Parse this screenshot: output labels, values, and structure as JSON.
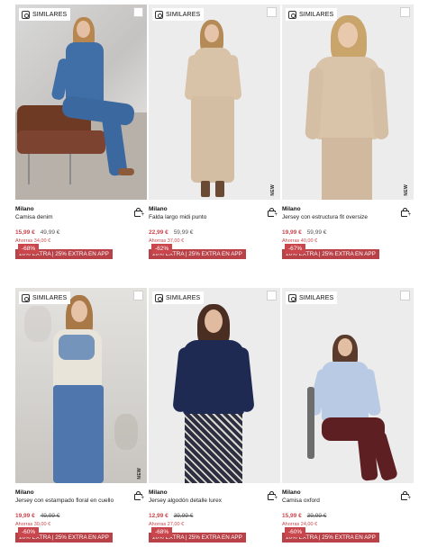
{
  "colors": {
    "discount_badge": "#c9464c",
    "promo_bar": "#b84248",
    "price": "#c9464c"
  },
  "similar_label": "SIMILARES",
  "products": [
    {
      "brand": "Milano",
      "name": "Camisa denim",
      "price": "15,99 €",
      "old_price": "49,99 €",
      "savings": "Ahorras 34,00 €",
      "discount": "-68%",
      "new_tag": "",
      "promo": "20% EXTRA | 25% EXTRA EN APP"
    },
    {
      "brand": "Milano",
      "name": "Falda largo midi punto",
      "price": "22,99 €",
      "old_price": "59,99 €",
      "savings": "Ahorras 37,00 €",
      "discount": "-62%",
      "new_tag": "NEW",
      "promo": "20% EXTRA | 25% EXTRA EN APP"
    },
    {
      "brand": "Milano",
      "name": "Jersey con estructura fit oversize",
      "price": "19,99 €",
      "old_price": "59,99 €",
      "savings": "Ahorras 40,00 €",
      "discount": "-67%",
      "new_tag": "NEW",
      "promo": "20% EXTRA | 25% EXTRA EN APP"
    },
    {
      "brand": "Milano",
      "name": "Jersey con estampado floral en cuello",
      "price": "19,99 €",
      "old_price": "49,99 €",
      "savings": "Ahorras 30,00 €",
      "discount": "-60%",
      "new_tag": "NEW",
      "promo": "20% EXTRA | 25% EXTRA EN APP"
    },
    {
      "brand": "Milano",
      "name": "Jersey algodón detalle lurex",
      "price": "12,99 €",
      "old_price": "39,99 €",
      "savings": "Ahorras 27,00 €",
      "discount": "-68%",
      "new_tag": "",
      "promo": "20% EXTRA | 25% EXTRA EN APP"
    },
    {
      "brand": "Milano",
      "name": "Camisa oxford",
      "price": "15,99 €",
      "old_price": "39,99 €",
      "savings": "Ahorras 24,00 €",
      "discount": "-60%",
      "new_tag": "",
      "promo": "20% EXTRA | 25% EXTRA EN APP"
    }
  ]
}
